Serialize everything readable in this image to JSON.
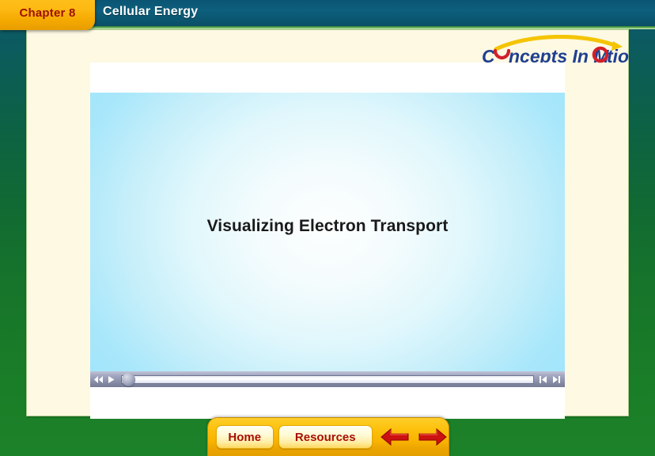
{
  "header": {
    "chapter_label": "Chapter 8",
    "title": "Cellular Energy",
    "logo": {
      "name": "concepts-in-motion-logo",
      "text_part1": "C",
      "text_part2": "ncepts In M",
      "text_part3": "tion",
      "full_text": "Concepts In Motion",
      "word_blue": "#1f3f91",
      "ring_red": "#d1202a",
      "swoosh_yellow": "#f5c400"
    }
  },
  "media": {
    "stage_title": "Visualizing Electron Transport",
    "controls": {
      "rewind_icon": "rewind-icon",
      "play_icon": "play-icon",
      "step_back_icon": "step-back-icon",
      "step_forward_icon": "step-forward-icon",
      "scrub_position_percent": 0
    }
  },
  "nav": {
    "home_label": "Home",
    "resources_label": "Resources",
    "back_arrow_icon": "arrow-left-icon",
    "forward_arrow_icon": "arrow-right-icon"
  },
  "colors": {
    "frame_green": "#1a7c28",
    "frame_teal": "#0d5a6e",
    "header_teal": "#0d5f7d",
    "tab_gold": "#fdb913",
    "tab_text_red": "#9d1006",
    "page_cream": "#fdf9e3",
    "nav_gold": "#f8b300",
    "nav_text_red": "#a80f07",
    "arrow_red": "#cc1111",
    "stage_blue": "#a2e5fb"
  }
}
